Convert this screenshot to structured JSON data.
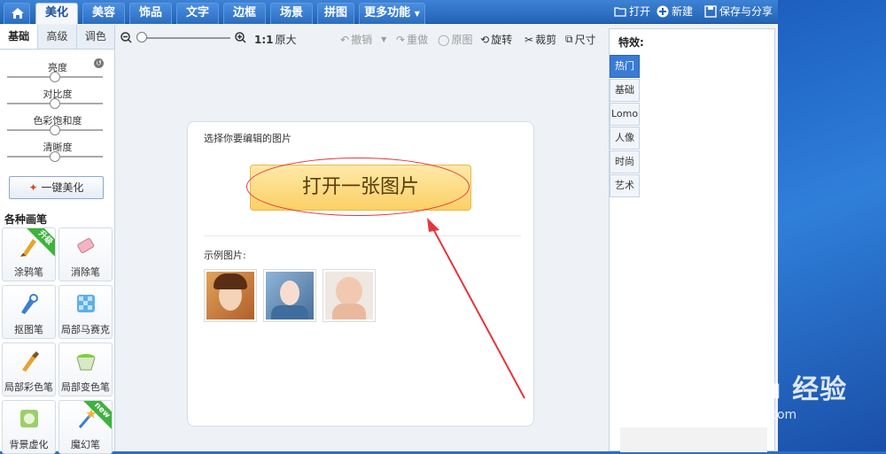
{
  "topbar": {
    "tabs": [
      "美化",
      "美容",
      "饰品",
      "文字",
      "边框",
      "场景",
      "拼图",
      "更多功能"
    ],
    "active_tab": "美化",
    "open_label": "打开",
    "new_label": "新建",
    "save_label": "保存与分享"
  },
  "left": {
    "subtabs": [
      "基础",
      "高级",
      "调色"
    ],
    "sliders": [
      {
        "label": "亮度",
        "value": 0.5
      },
      {
        "label": "对比度",
        "value": 0.5
      },
      {
        "label": "色彩饱和度",
        "value": 0.5
      },
      {
        "label": "清晰度",
        "value": 0.5
      }
    ],
    "one_key_label": "一键美化",
    "pens_title": "各种画笔",
    "pens": [
      {
        "label": "涂鸦笔",
        "badge": "升级"
      },
      {
        "label": "消除笔",
        "badge": ""
      },
      {
        "label": "抠图笔",
        "badge": ""
      },
      {
        "label": "局部马赛克",
        "badge": ""
      },
      {
        "label": "局部彩色笔",
        "badge": ""
      },
      {
        "label": "局部变色笔",
        "badge": ""
      },
      {
        "label": "背景虚化",
        "badge": ""
      },
      {
        "label": "魔幻笔",
        "badge": "new"
      }
    ]
  },
  "toolbar": {
    "zoom_ratio": "1:1",
    "original_size": "原大",
    "undo": "撤销",
    "redo": "重做",
    "original": "原图",
    "rotate": "旋转",
    "crop": "裁剪",
    "size": "尺寸"
  },
  "canvas": {
    "prompt": "选择你要编辑的图片",
    "open_button": "打开一张图片",
    "sample_label": "示例图片:"
  },
  "effects": {
    "title": "特效:",
    "tabs": [
      "热门",
      "基础",
      "Lomo",
      "人像",
      "时尚",
      "艺术"
    ],
    "active": "热门"
  },
  "watermark": {
    "line1": "Bai du 经验",
    "line2": "jingyan.baidu.com"
  },
  "colors": {
    "accent": "#3a7bd5",
    "highlight": "#e4363c",
    "button": "#fbd066"
  }
}
